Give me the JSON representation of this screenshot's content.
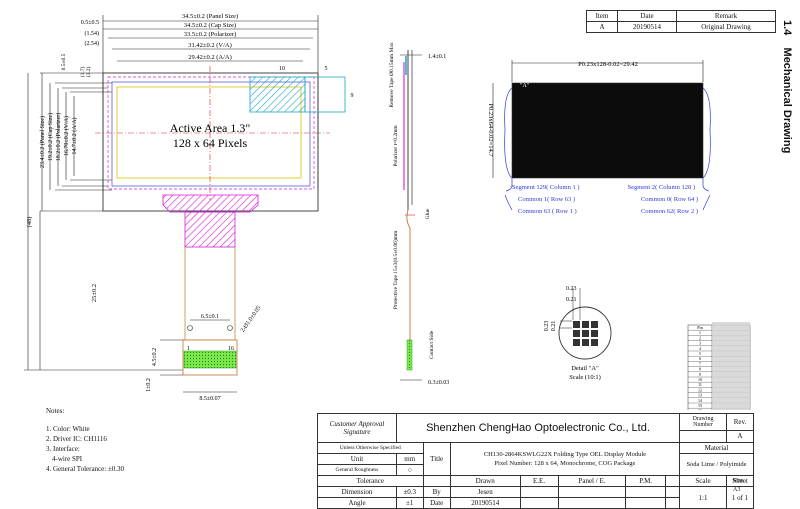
{
  "section": {
    "number": "1.4",
    "title": "Mechanical Drawing"
  },
  "revision_table": {
    "headers": [
      "Item",
      "Date",
      "Remark"
    ],
    "rows": [
      [
        "A",
        "20190514",
        "Original Drawing"
      ]
    ]
  },
  "front_view": {
    "dims_top": [
      "34.5±0.2 (Panel Size)",
      "34.5±0.2 (Cap Size)",
      "33.5±0.2 (Polarizer)",
      "31.42±0.2 (V/A)",
      "29.42±0.2 (A/A)"
    ],
    "dims_top_left": [
      "0.5±0.5",
      "(1.54)",
      "(2.54)",
      "0.5±0.5"
    ],
    "small_dims": [
      "10",
      "5",
      "9"
    ],
    "dims_left": [
      "14.7±0.2 (A/A)",
      "16.70±0.2 (V/A)",
      "18.2±0.2 (Polarizer)",
      "19.2±0.2 (Cap Size)",
      "23.4±0.2 (Panel Size)"
    ],
    "dim_48": "(48)",
    "dim_25": "25±0.2",
    "small_left": [
      "(1.7)",
      "(3.2)"
    ],
    "active_area_line1": "Active Area 1.3\"",
    "active_area_line2": "128 x 64 Pixels",
    "fpc_dims": [
      "6.5±0.1",
      "2-Ø1.0±0.05",
      "4.5±0.2",
      "8.5±0.07",
      "1±0.2"
    ],
    "pin1": "1",
    "pin16": "16"
  },
  "side_view": {
    "labels": [
      "Remove Tape Ø0.15mm Max",
      "Polarizer t=0.2mm",
      "Glue",
      "Protective Tape 15±3(0.5±0.06)mm",
      "Contact Side"
    ],
    "top_dim": "1.4±0.1",
    "bottom_dim": "0.3±0.03"
  },
  "panel_view": {
    "top_dim": "P0.23x128-0.02=29.42",
    "left_dim": "P0.23x64-0.02=14.7",
    "marker": "\"A\"",
    "segments": [
      "Segment 129( Column 1 )",
      "Segment 2( Column 128 )",
      "Common 1( Row 63 )",
      "Common 0( Row 64 )",
      "Common 63 ( Row 1 )",
      "Common 62( Row 2 )"
    ]
  },
  "detail": {
    "dims": [
      "0.23",
      "0.21",
      "0.23",
      "0.21"
    ],
    "title": "Detail \"A\"",
    "scale": "Scale (10:1)"
  },
  "pin_table": {
    "header": "Pin",
    "pins": [
      "1",
      "2",
      "3",
      "4",
      "5",
      "6",
      "7",
      "8",
      "9",
      "10",
      "11",
      "12",
      "13",
      "14",
      "15",
      "16"
    ]
  },
  "notes": {
    "title": "Notes:",
    "items": [
      "1. Color: White",
      "2. Driver IC: CH1116",
      "3. Interface:",
      "     4-wire SPI",
      "4. General Tolerance: ±0.30"
    ]
  },
  "title_block": {
    "approval_label": "Customer Approval Signature",
    "company": "Shenzhen ChengHao Optoelectronic Co., Ltd.",
    "drawing_number_label": "Drawing Number",
    "rev_label": "Rev.",
    "rev_value": "A",
    "unless_label": "Unless Otherwise Specified",
    "unit_label": "Unit",
    "unit_value": "mm",
    "roughness_label": "General Roughness",
    "title_label": "Title",
    "title_text_1": "CH130-2864KSWLG22X Folding Type OEL Display Module",
    "title_text_2": "Pixel Number: 128 x 64, Monochrome, COG Package",
    "material_label": "Material",
    "material_value": "Soda Lime / Polyimide",
    "tolerance_label": "Tolerance",
    "drawn_label": "Drawn",
    "ee_label": "E.E.",
    "panel_fe_label": "Panel / E.",
    "pm_label": "P.M.",
    "dimension_label": "Dimension",
    "dimension_value": "±0.3",
    "by_label": "By",
    "drawn_by": "Jesen",
    "scale_label": "Scale",
    "sheet_label": "Sheet",
    "size_label": "Size",
    "angle_label": "Angle",
    "angle_value": "±1",
    "date_label": "Date",
    "date_value": "20190514",
    "scale_value": "1:1",
    "sheet_value": "1 of 1",
    "size_value": "A3"
  }
}
